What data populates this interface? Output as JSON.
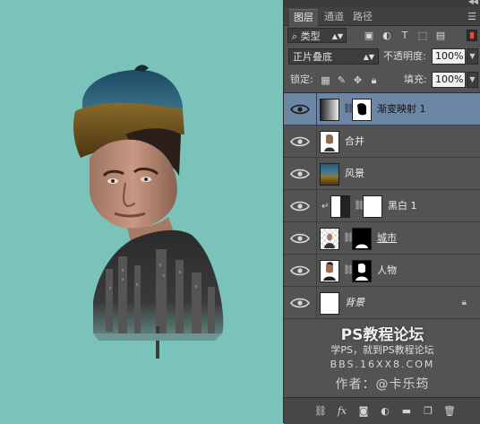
{
  "panel": {
    "tabs": [
      {
        "label": "图层",
        "active": true
      },
      {
        "label": "通道",
        "active": false
      },
      {
        "label": "路径",
        "active": false
      }
    ],
    "filter_label": "类型",
    "blend_mode": "正片叠底",
    "opacity_label": "不透明度:",
    "opacity_value": "100%",
    "lock_label": "锁定:",
    "fill_label": "填充:",
    "fill_value": "100%",
    "layers": [
      {
        "name": "渐变映射 1",
        "selected": true
      },
      {
        "name": "合并",
        "selected": false
      },
      {
        "name": "风景",
        "selected": false
      },
      {
        "name": "黑白 1",
        "selected": false
      },
      {
        "name": "城市",
        "selected": false
      },
      {
        "name": "人物",
        "selected": false
      },
      {
        "name": "背景",
        "selected": false
      }
    ]
  },
  "watermark": {
    "title": "PS教程论坛",
    "subtitle": "学PS，就到PS教程论坛",
    "url": "BBS.16XX8.COM",
    "author": "作者：@卡乐筠"
  },
  "colors": {
    "canvas_bg": "#7ac3bb",
    "panel_bg": "#535353",
    "selected_layer": "#6d86a6"
  }
}
